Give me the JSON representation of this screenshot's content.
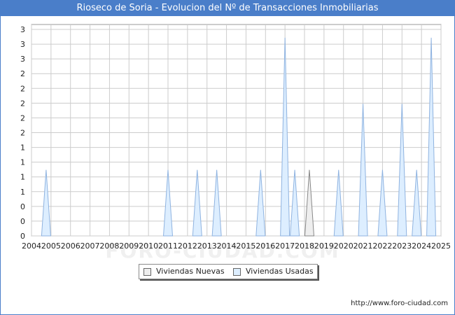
{
  "title": "Rioseco de Soria - Evolucion del Nº de Transacciones Inmobiliarias",
  "footer_url": "http://www.foro-ciudad.com",
  "watermark": "FORO-CIUDAD.COM",
  "legend": {
    "nuevas": "Viviendas Nuevas",
    "usadas": "Viviendas Usadas"
  },
  "colors": {
    "title_bg": "#4a7ec9",
    "usadas_fill": "#ddeeff",
    "usadas_stroke": "#8fb3e0",
    "nuevas_fill": "#eeeeee",
    "nuevas_stroke": "#888888",
    "grid": "#cccccc"
  },
  "chart_data": {
    "type": "area",
    "title": "Rioseco de Soria - Evolucion del Nº de Transacciones Inmobiliarias",
    "x_tick_labels": [
      "2004",
      "2005",
      "2006",
      "2007",
      "2008",
      "2009",
      "2010",
      "2011",
      "2012",
      "2013",
      "2014",
      "2015",
      "2016",
      "2017",
      "2018",
      "2019",
      "2020",
      "2021",
      "2022",
      "2023",
      "2024",
      "2025"
    ],
    "y_tick_labels": [
      "0",
      "0",
      "0",
      "1",
      "1",
      "1",
      "1",
      "2",
      "2",
      "2",
      "2",
      "2",
      "3",
      "3",
      "3"
    ],
    "xlim": [
      2004,
      2025
    ],
    "ylim": [
      0,
      3.2
    ],
    "grid": true,
    "legend_position": "bottom",
    "series": [
      {
        "name": "Viviendas Nuevas",
        "peaks": [
          {
            "x": 2018.25,
            "y": 1
          }
        ]
      },
      {
        "name": "Viviendas Usadas",
        "peaks": [
          {
            "x": 2004.75,
            "y": 1
          },
          {
            "x": 2011.0,
            "y": 1
          },
          {
            "x": 2012.5,
            "y": 1
          },
          {
            "x": 2013.5,
            "y": 1
          },
          {
            "x": 2015.75,
            "y": 1
          },
          {
            "x": 2017.0,
            "y": 3
          },
          {
            "x": 2017.5,
            "y": 1
          },
          {
            "x": 2019.75,
            "y": 1
          },
          {
            "x": 2021.0,
            "y": 2
          },
          {
            "x": 2022.0,
            "y": 1
          },
          {
            "x": 2023.0,
            "y": 2
          },
          {
            "x": 2023.75,
            "y": 1
          },
          {
            "x": 2024.5,
            "y": 3
          }
        ]
      }
    ]
  }
}
